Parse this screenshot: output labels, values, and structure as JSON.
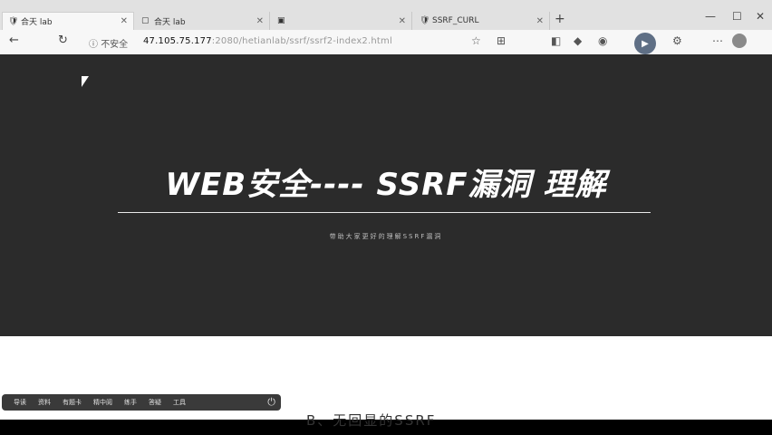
{
  "tabs": [
    {
      "label": "合天 lab",
      "icon": "shield-icon"
    },
    {
      "label": "合天 lab",
      "icon": "page-icon"
    },
    {
      "label": "",
      "icon": "app-icon"
    },
    {
      "label": "SSRF_CURL",
      "icon": "shield-icon"
    }
  ],
  "toolbar": {
    "security_label": "不安全",
    "url_host": "47.105.75.177",
    "url_path": ":2080/hetianlab/ssrf/ssrf2-index2.html"
  },
  "slide": {
    "title": "WEB安全---- SSRF漏洞 理解",
    "subtitle": "带助大家更好的理解SSRF漏洞"
  },
  "next": {
    "heading": "B、无回显的SSRF"
  },
  "player": {
    "items": [
      "导读",
      "资料",
      "有题卡",
      "精中阅",
      "练手",
      "答疑",
      "工具"
    ]
  }
}
